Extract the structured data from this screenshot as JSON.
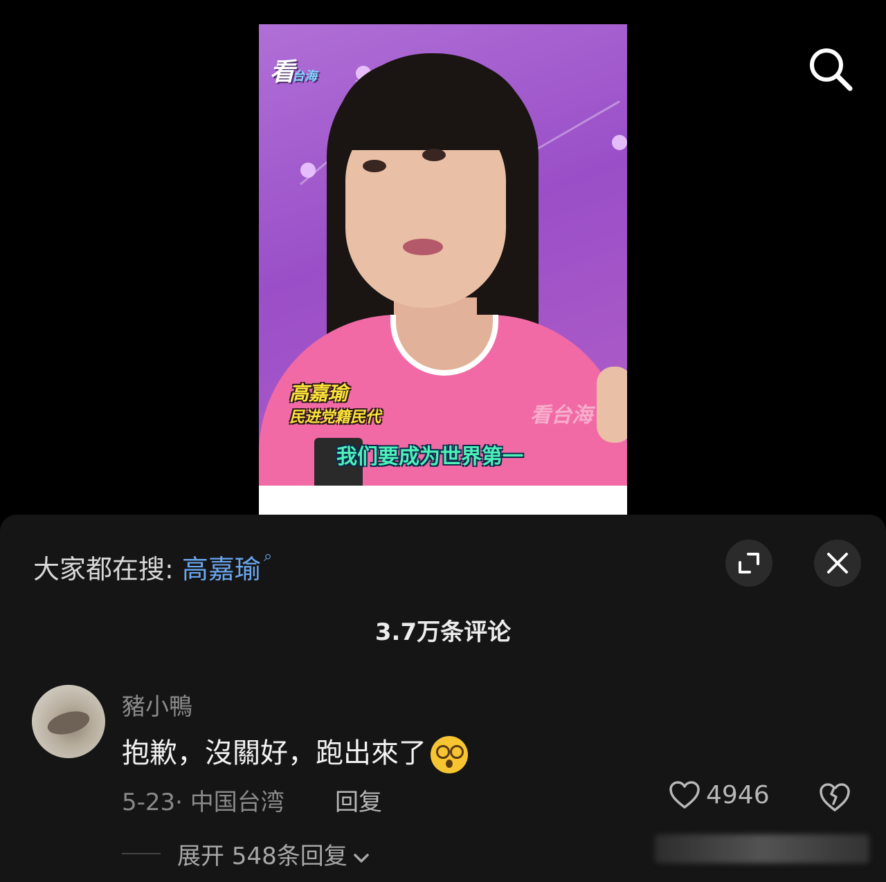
{
  "video": {
    "top_caption": "",
    "channel_logo": "看",
    "channel_logo_sub": "台海",
    "watermark": "看台海",
    "name_tag": "高嘉瑜",
    "title_tag": "民进党籍民代",
    "subtitle": "我们要成为世界第一",
    "search_icon": "search-icon"
  },
  "comments_panel": {
    "hot_search_prefix": "大家都在搜:",
    "hot_search_term": "高嘉瑜",
    "hot_search_glyph": "⌕",
    "expand_icon": "expand-icon",
    "close_icon": "close-icon",
    "comment_count": "3.7万条评论",
    "comment": {
      "username": "豬小鴨",
      "text": "抱歉，沒關好，跑出來了",
      "emoji": "dizzy-face-emoji",
      "meta": "5-23· 中国台湾",
      "reply_label": "回复",
      "like_count": "4946",
      "expand_replies": "展开 548条回复"
    }
  },
  "colors": {
    "accent_link": "#6aa6ee",
    "sheet_bg": "#151515",
    "video_bg": "#9a4fc8",
    "sweater": "#f16aa5"
  }
}
